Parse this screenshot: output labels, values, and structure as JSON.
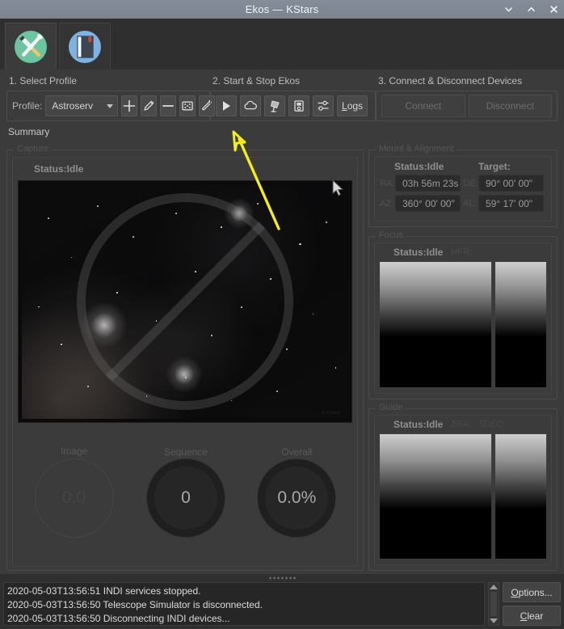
{
  "window": {
    "title": "Ekos — KStars",
    "controls": [
      {
        "name": "minimize",
        "glyph": "chevron-down"
      },
      {
        "name": "maximize",
        "glyph": "chevron-up"
      },
      {
        "name": "close",
        "glyph": "x"
      }
    ]
  },
  "tabs": [
    {
      "id": "setup",
      "icon": "tools-icon",
      "selected": true
    },
    {
      "id": "scheduler",
      "icon": "book-icon",
      "selected": false
    }
  ],
  "steps": {
    "step1_title": "1. Select Profile",
    "step2_title": "2. Start & Stop Ekos",
    "step3_title": "3. Connect & Disconnect Devices",
    "profile_label": "Profile:",
    "profile_value": "Astroserv",
    "profile_buttons": [
      {
        "name": "add-profile-button",
        "icon": "plus-icon"
      },
      {
        "name": "edit-profile-button",
        "icon": "pencil-icon"
      },
      {
        "name": "delete-profile-button",
        "icon": "minus-icon"
      },
      {
        "name": "scan-profile-button",
        "icon": "dice-icon"
      },
      {
        "name": "wizard-profile-button",
        "icon": "wand-icon"
      }
    ],
    "ekos_buttons": [
      {
        "name": "start-ekos-button",
        "icon": "play-icon"
      },
      {
        "name": "cloud-button",
        "icon": "cloud-icon"
      },
      {
        "name": "mount-button",
        "icon": "telescope-icon"
      },
      {
        "name": "device-manager-button",
        "icon": "device-icon"
      },
      {
        "name": "options-sliders-button",
        "icon": "sliders-icon"
      }
    ],
    "logs_label": "Logs",
    "logs_mnemonic": "L",
    "connect_label": "Connect",
    "connect_mnemonic": "n",
    "disconnect_label": "Disconnect",
    "disconnect_mnemonic": "D"
  },
  "summary": {
    "label": "Summary",
    "capture": {
      "group_title": "Capture",
      "status_label": "Status:",
      "status_value": "Idle",
      "preview_watermark": "© KStars",
      "gauges": [
        {
          "name": "image-gauge",
          "caption": "Image",
          "value": "0.0",
          "style": "hollow"
        },
        {
          "name": "sequence-gauge",
          "caption": "Sequence",
          "value": "0",
          "style": "filled"
        },
        {
          "name": "overall-gauge",
          "caption": "Overall",
          "value": "0.0%",
          "style": "filled"
        }
      ]
    },
    "mount": {
      "group_title": "Mount & Alignment",
      "status_label": "Status:",
      "status_value": "Idle",
      "target_label": "Target:",
      "ra_label": "RA:",
      "ra_value": "03h 56m 23s",
      "de_label": "DE:",
      "de_value": "90° 00' 00\"",
      "az_label": "AZ:",
      "az_value": "360° 00' 00\"",
      "al_label": "AL:",
      "al_value": "59° 17' 00\""
    },
    "focus": {
      "group_title": "Focus",
      "status_label": "Status:",
      "status_value": "Idle",
      "hfr_label": "HFR:"
    },
    "guide": {
      "group_title": "Guide",
      "status_label": "Status:",
      "status_value": "Idle",
      "dra_label": "δRA:",
      "ddec_label": "δDEC:"
    }
  },
  "log": {
    "lines": [
      "2020-05-03T13:56:51 INDI services stopped.",
      "2020-05-03T13:56:50 Telescope Simulator is disconnected.",
      "2020-05-03T13:56:50 Disconnecting INDI devices..."
    ],
    "options_label": "Options...",
    "options_mnemonic": "O",
    "clear_label": "Clear",
    "clear_mnemonic": "C"
  },
  "colors": {
    "titlebar": "#7d8794",
    "window_bg": "#3b3b3b",
    "annotation_arrow": "#f5ed18"
  }
}
